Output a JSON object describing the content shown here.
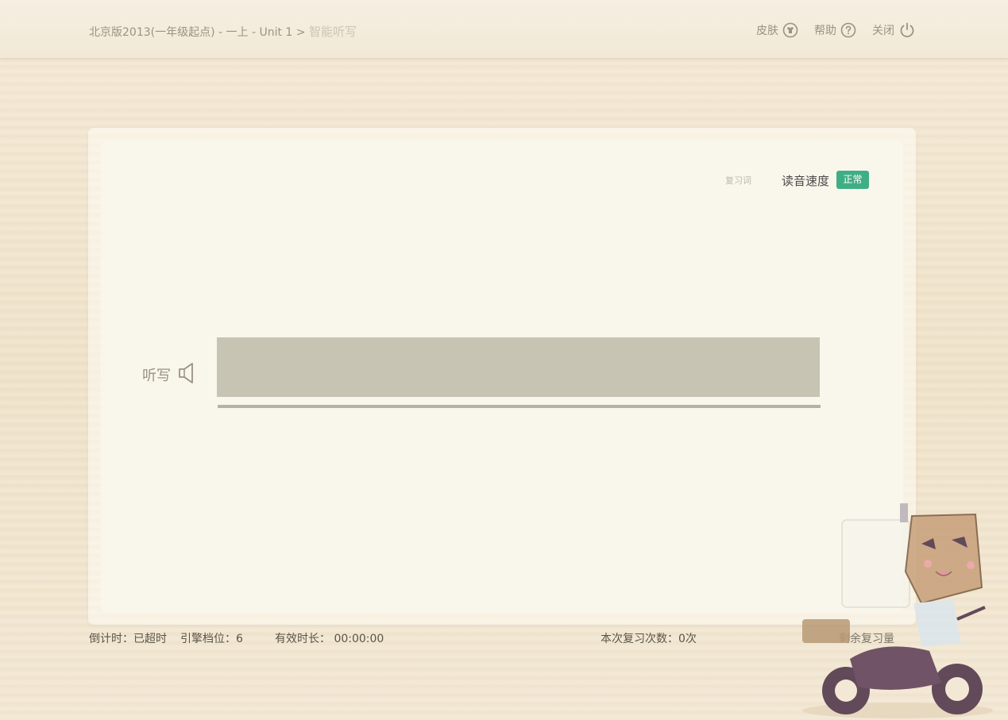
{
  "header": {
    "breadcrumb_path": "北京版2013(一年级起点) - 一上 - Unit 1  >",
    "breadcrumb_current": "智能听写",
    "skin_label": "皮肤",
    "help_label": "帮助",
    "close_label": "关闭"
  },
  "panel": {
    "review_words_label": "复习词",
    "speed_label": "读音速度",
    "speed_value": "正常",
    "dictation_label": "听写",
    "answer_value": ""
  },
  "status": {
    "countdown": "倒计时：已超时",
    "gear": "引擎档位：6",
    "duration": "有效时长： 00:00:00",
    "review_count": "本次复习次数：0次",
    "remaining": "剩余复习量"
  },
  "colors": {
    "accent_green": "#3fae85",
    "answer_box": "#c7c4b4",
    "panel_bg": "#f9f6ec"
  },
  "icons": [
    "skin-icon",
    "help-icon",
    "power-icon",
    "speaker-icon"
  ]
}
